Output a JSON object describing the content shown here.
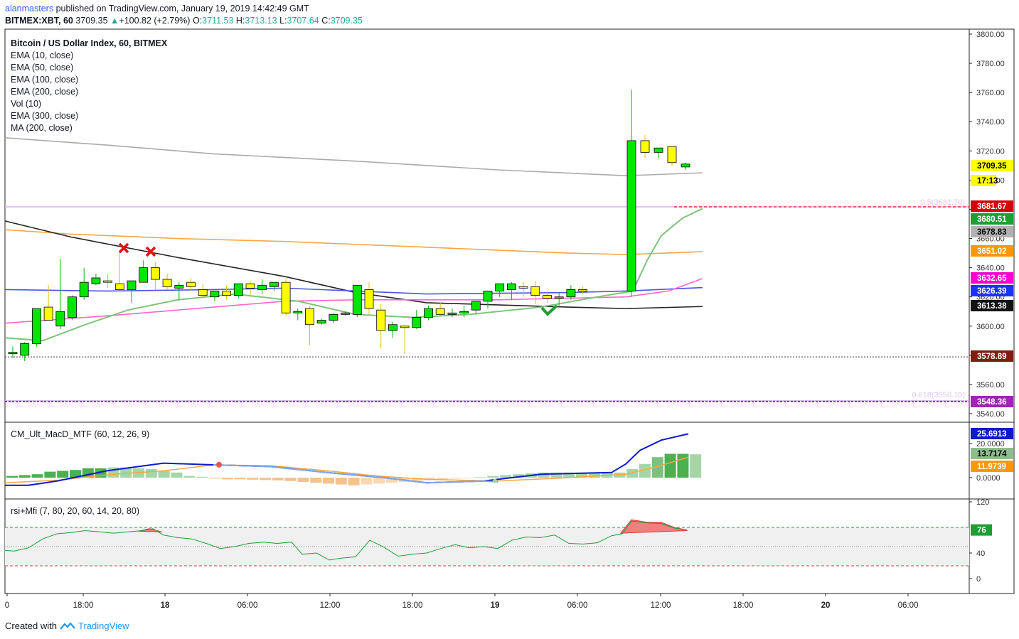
{
  "header": {
    "user": "alanmasters",
    "published": "published on TradingView.com, January 19, 2019 14:42:49 GMT",
    "symbol": "BITMEX:XBT, 60",
    "last": "3709.35",
    "change": "+100.82 (+2.79%)",
    "o_label": "O:",
    "o": "3711.53",
    "h_label": "H:",
    "h": "3713.13",
    "l_label": "L:",
    "l": "3707.64",
    "c_label": "C:",
    "c": "3709.35"
  },
  "legend": {
    "title": "Bitcoin / US Dollar Index, 60, BITMEX",
    "items": [
      "EMA (10, close)",
      "EMA (50, close)",
      "EMA (100, close)",
      "EMA (200, close)",
      "Vol (10)",
      "EMA (300, close)",
      "MA (200, close)"
    ]
  },
  "macd_label": "CM_Ult_MacD_MTF (60, 12, 26, 9)",
  "rsi_label": "rsi+Mfi (7, 80, 20, 60, 14, 20, 80)",
  "footer": {
    "created": "Created with",
    "brand": "TradingView"
  },
  "colors": {
    "up": "#00e600",
    "down": "#ffff00",
    "ema10": "#7dc47d",
    "ema50": "#ff66cc",
    "ema100": "#4040ff",
    "ema200": "#f5a742",
    "ema300": "#222222",
    "ma200": "#aaaaaa"
  },
  "chart_data": [
    {
      "type": "candlestick",
      "name": "price",
      "ylim": [
        3535,
        3805
      ],
      "yticks": [
        "3800.00",
        "3780.00",
        "3760.00",
        "3740.00",
        "3720.00",
        "3700.00",
        "3680.00",
        "3660.00",
        "3640.00",
        "3620.00",
        "3600.00",
        "3580.00",
        "3560.00",
        "3540.00"
      ],
      "xticks": [
        "0",
        "18:00",
        "18",
        "06:00",
        "12:00",
        "18:00",
        "19",
        "06:00",
        "12:00",
        "18:00",
        "20",
        "06:00"
      ],
      "candles": [
        [
          3582,
          3586,
          3578,
          3582
        ],
        [
          3580,
          3589,
          3576,
          3588
        ],
        [
          3588,
          3600,
          3586,
          3612
        ],
        [
          3613,
          3628,
          3605,
          3604
        ],
        [
          3600,
          3646,
          3598,
          3610
        ],
        [
          3606,
          3621,
          3604,
          3620
        ],
        [
          3620,
          3640,
          3618,
          3630
        ],
        [
          3629,
          3636,
          3628,
          3633
        ],
        [
          3631,
          3636,
          3626,
          3630
        ],
        [
          3629,
          3651,
          3625,
          3625
        ],
        [
          3625,
          3631,
          3616,
          3631
        ],
        [
          3630,
          3645,
          3630,
          3640
        ],
        [
          3640,
          3644,
          3625,
          3632
        ],
        [
          3632,
          3636,
          3625,
          3627
        ],
        [
          3626,
          3630,
          3618,
          3628
        ],
        [
          3630,
          3633,
          3624,
          3627
        ],
        [
          3625,
          3629,
          3620,
          3621
        ],
        [
          3620,
          3622,
          3617,
          3624
        ],
        [
          3624,
          3628,
          3618,
          3621
        ],
        [
          3621,
          3628,
          3619,
          3629
        ],
        [
          3629,
          3631,
          3620,
          3626
        ],
        [
          3625,
          3632,
          3622,
          3628
        ],
        [
          3627,
          3630,
          3624,
          3630
        ],
        [
          3630,
          3633,
          3607,
          3609
        ],
        [
          3610,
          3612,
          3604,
          3610
        ],
        [
          3612,
          3614,
          3587,
          3601
        ],
        [
          3602,
          3605,
          3601,
          3604
        ],
        [
          3604,
          3609,
          3602,
          3608
        ],
        [
          3608,
          3610,
          3607,
          3609
        ],
        [
          3608,
          3628,
          3606,
          3628
        ],
        [
          3625,
          3630,
          3608,
          3612
        ],
        [
          3611,
          3615,
          3585,
          3597
        ],
        [
          3597,
          3603,
          3592,
          3601
        ],
        [
          3600,
          3600,
          3581,
          3599
        ],
        [
          3599,
          3611,
          3598,
          3606
        ],
        [
          3606,
          3614,
          3604,
          3612
        ],
        [
          3612,
          3616,
          3607,
          3608
        ],
        [
          3608,
          3612,
          3606,
          3609
        ],
        [
          3609,
          3614,
          3606,
          3610
        ],
        [
          3611,
          3613,
          3608,
          3617
        ],
        [
          3617,
          3618,
          3612,
          3624
        ],
        [
          3624,
          3628,
          3620,
          3629
        ],
        [
          3625,
          3630,
          3618,
          3629
        ],
        [
          3627,
          3630,
          3620,
          3626
        ],
        [
          3627,
          3631,
          3615,
          3621
        ],
        [
          3621,
          3624,
          3616,
          3619
        ],
        [
          3619,
          3623,
          3614,
          3620
        ],
        [
          3620,
          3628,
          3618,
          3625
        ],
        [
          3625,
          3627,
          3622,
          3624
        ],
        [
          3624,
          3762,
          3620,
          3727
        ],
        [
          3727,
          3731,
          3715,
          3719
        ],
        [
          3719,
          3722,
          3715,
          3722
        ],
        [
          3723,
          3723,
          3710,
          3712
        ],
        [
          3709,
          3712,
          3707,
          3711
        ]
      ],
      "series": [
        {
          "name": "EMA (10, close)",
          "color": "#7dc47d",
          "last": "3680.51"
        },
        {
          "name": "EMA (50, close)",
          "color": "#ff66cc",
          "last": "3632.65"
        },
        {
          "name": "EMA (100, close)",
          "color": "#4040ff",
          "last": "3626.39"
        },
        {
          "name": "EMA (200, close)",
          "color": "#f5a742",
          "last": "3651.02"
        },
        {
          "name": "EMA (300, close)",
          "color": "#222222",
          "last": "3613.38"
        },
        {
          "name": "MA (200, close)",
          "color": "#aaaaaa",
          "last": "3678.83"
        }
      ],
      "price_tags": [
        {
          "value": "3709.35",
          "bg": "#ffff00",
          "fg": "#000000"
        },
        {
          "value": "17:13",
          "bg": "#ffff00",
          "fg": "#000000"
        },
        {
          "value": "3681.67",
          "bg": "#d50000",
          "fg": "#ffffff"
        },
        {
          "value": "3680.51",
          "bg": "#1e9e33",
          "fg": "#ffffff"
        },
        {
          "value": "3678.83",
          "bg": "#b2b2b2",
          "fg": "#000000"
        },
        {
          "value": "3651.02",
          "bg": "#ff9800",
          "fg": "#ffffff"
        },
        {
          "value": "3632.65",
          "bg": "#ff00cc",
          "fg": "#ffffff"
        },
        {
          "value": "3626.39",
          "bg": "#1a34ff",
          "fg": "#ffffff"
        },
        {
          "value": "3613.38",
          "bg": "#131313",
          "fg": "#ffffff"
        },
        {
          "value": "3578.89",
          "bg": "#7b1f12",
          "fg": "#ffffff"
        },
        {
          "value": "3548.36",
          "bg": "#9c27b0",
          "fg": "#ffffff"
        }
      ],
      "fib": [
        {
          "label": "0.5(3681.70)",
          "value": 3681.7
        },
        {
          "label": "0.618(3550.10)",
          "value": 3550.1
        }
      ],
      "hlines": [
        {
          "value": 3681.67,
          "style": "dashed-red"
        },
        {
          "value": 3578.89,
          "style": "dotted-dark"
        },
        {
          "value": 3548.36,
          "style": "dotted-purple"
        }
      ]
    },
    {
      "type": "bar+line",
      "name": "CM_Ult_MacD_MTF",
      "yticks": [
        "20.0000",
        "0.0000"
      ],
      "price_tags": [
        {
          "value": "25.6913",
          "bg": "#0d1acc",
          "fg": "#ffffff"
        },
        {
          "value": "13.7174",
          "bg": "#8fbc8f",
          "fg": "#000000"
        },
        {
          "value": "11.9739",
          "bg": "#ff9800",
          "fg": "#ffffff"
        }
      ]
    },
    {
      "type": "line",
      "name": "rsi+Mfi",
      "ylim": [
        -10,
        120
      ],
      "yticks": [
        "120",
        "40",
        "0"
      ],
      "price_tags": [
        {
          "value": "76",
          "bg": "#1e9e33",
          "fg": "#ffffff"
        }
      ]
    }
  ]
}
